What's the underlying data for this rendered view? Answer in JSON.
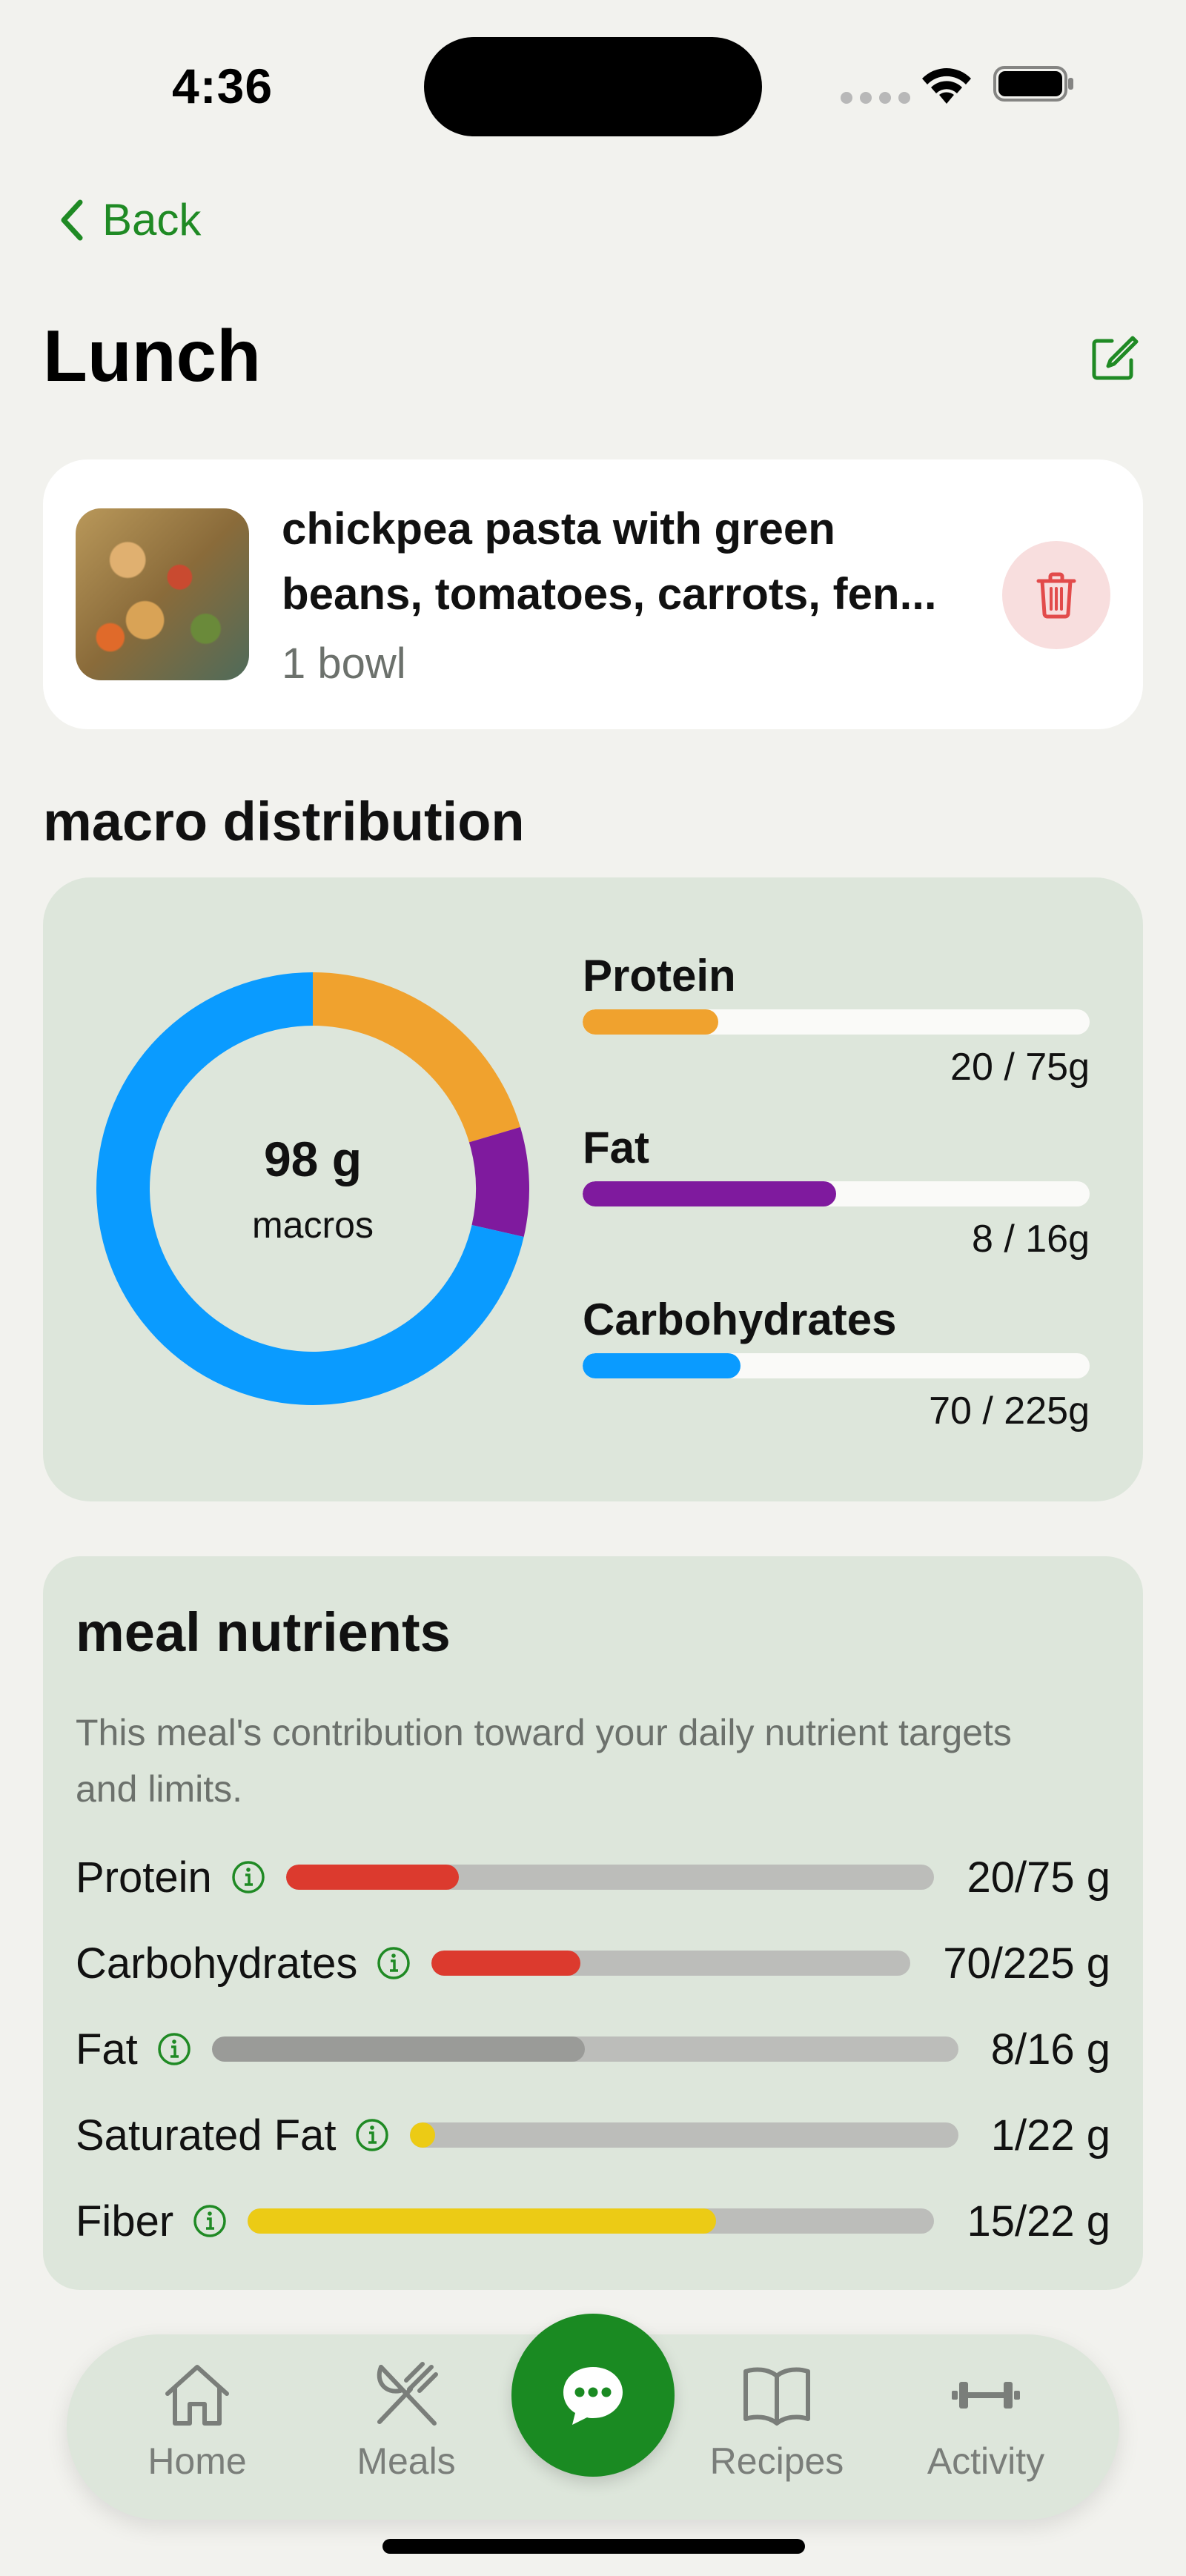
{
  "status_bar": {
    "time": "4:36"
  },
  "header": {
    "back_label": "Back",
    "title": "Lunch"
  },
  "food_item": {
    "name_line1": "chickpea pasta with green",
    "name_line2": "beans, tomatoes, carrots, fen...",
    "quantity": "1 bowl"
  },
  "macro_section": {
    "title": "macro distribution",
    "total": "98 g",
    "caption": "macros",
    "items": [
      {
        "name": "Protein",
        "amount": "20 / 75g",
        "fraction": 0.267,
        "color": "#f0a22e"
      },
      {
        "name": "Fat",
        "amount": "8 / 16g",
        "fraction": 0.5,
        "color": "#7f1a9e"
      },
      {
        "name": "Carbohydrates",
        "amount": "70 / 225g",
        "fraction": 0.311,
        "color": "#0a9bff"
      }
    ]
  },
  "chart_data": {
    "type": "pie",
    "categories": [
      "Protein",
      "Fat",
      "Carbohydrates"
    ],
    "values": [
      20,
      8,
      70
    ],
    "colors": [
      "#f0a22e",
      "#7f1a9e",
      "#0a9bff"
    ],
    "center_text": "98 g",
    "center_caption": "macros"
  },
  "nutrients_section": {
    "title": "meal nutrients",
    "description": "This meal's contribution toward your daily nutrient targets and limits.",
    "rows": [
      {
        "label": "Protein",
        "value": "20/75 g",
        "fraction": 0.267,
        "color": "#dc3a2e"
      },
      {
        "label": "Carbohydrates",
        "value": "70/225 g",
        "fraction": 0.311,
        "color": "#dc3a2e"
      },
      {
        "label": "Fat",
        "value": "8/16 g",
        "fraction": 0.5,
        "color": "#9a9b98"
      },
      {
        "label": "Saturated Fat",
        "value": "1/22 g",
        "fraction": 0.045,
        "color": "#eccb15"
      },
      {
        "label": "Fiber",
        "value": "15/22 g",
        "fraction": 0.682,
        "color": "#eccb15"
      }
    ]
  },
  "tab_bar": {
    "home": "Home",
    "meals": "Meals",
    "recipes": "Recipes",
    "activity": "Activity",
    "chat_icon": "chat-bubble-icon"
  },
  "colors": {
    "accent": "#1a8a22",
    "card": "#dde6db",
    "background": "#f2f2ee"
  }
}
